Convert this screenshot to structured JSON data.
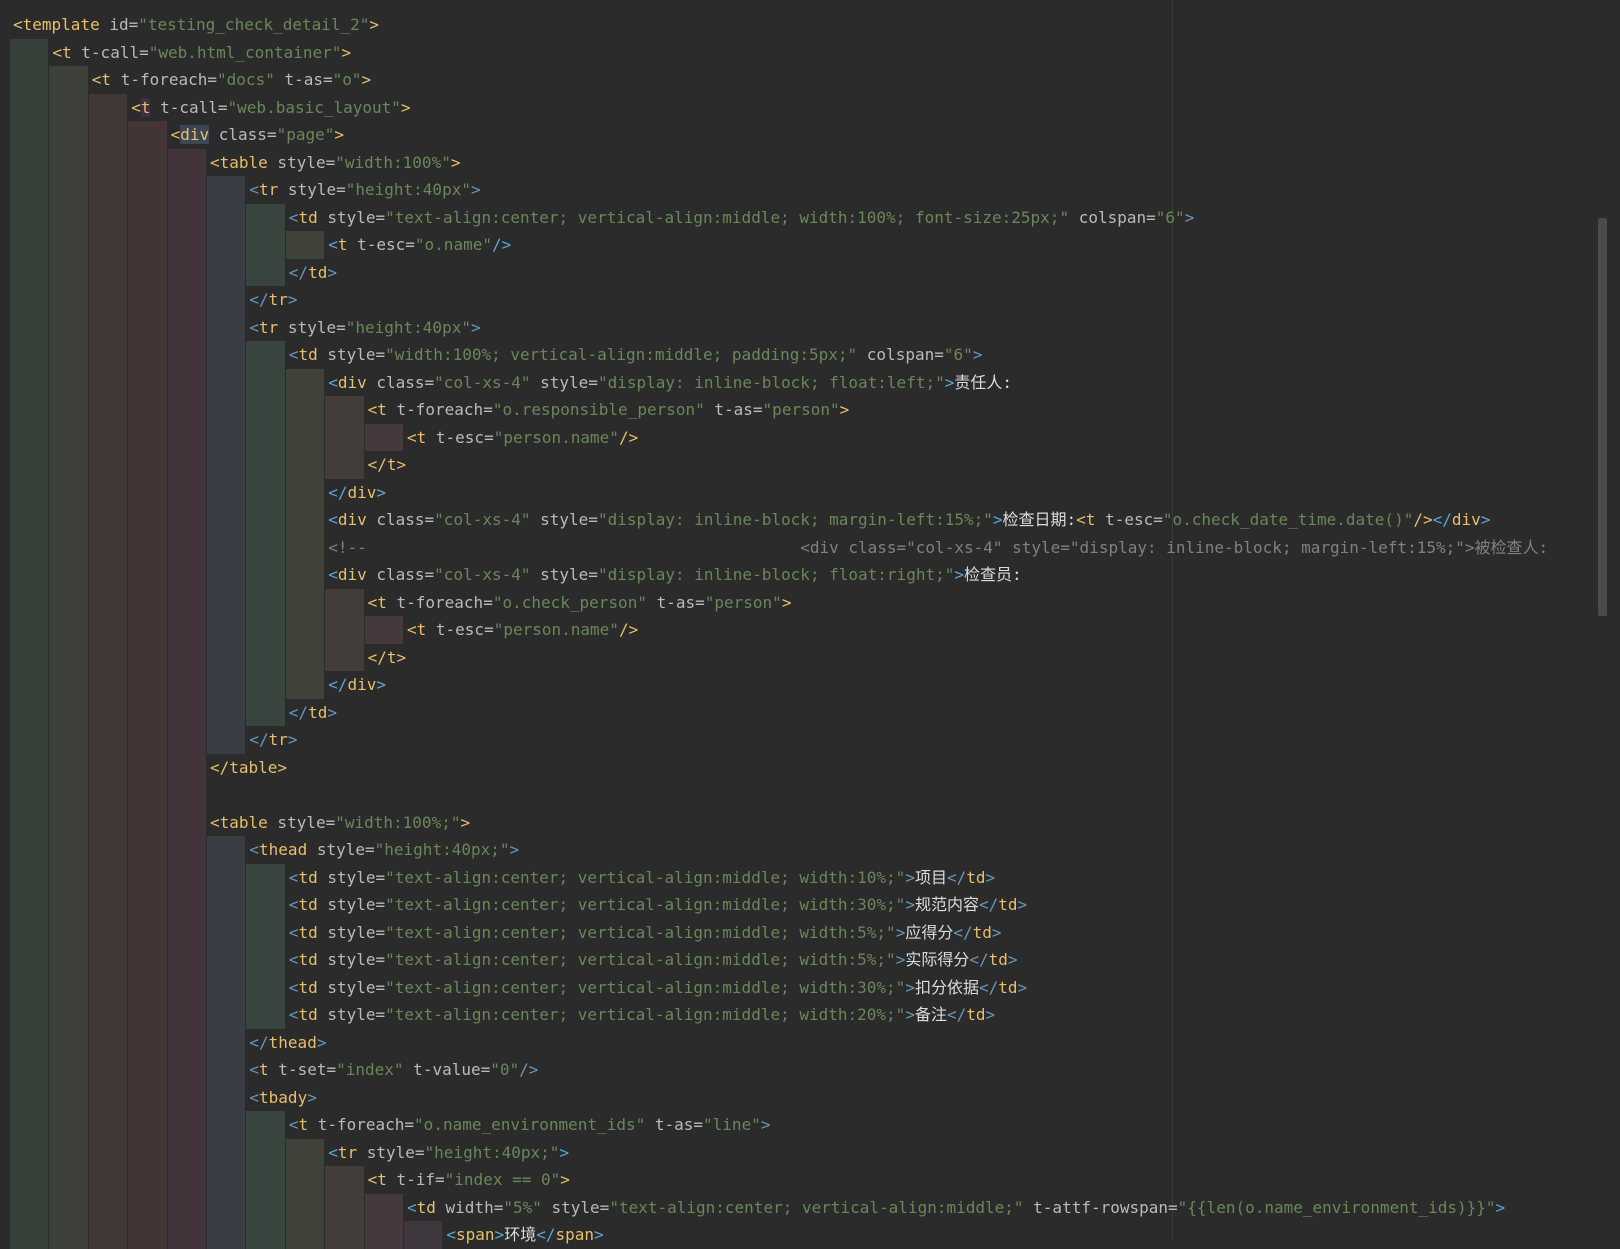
{
  "lines": [
    {
      "indent": 0,
      "tokens": [
        [
          "t",
          "<"
        ],
        [
          "t",
          "template"
        ],
        [
          "a",
          " id="
        ],
        [
          "s",
          "\"testing_check_detail_2\""
        ],
        [
          "t",
          ">"
        ]
      ]
    },
    {
      "indent": 1,
      "tokens": [
        [
          "t",
          "<t"
        ],
        [
          "a",
          " t-call="
        ],
        [
          "s",
          "\"web.html_container\""
        ],
        [
          "t",
          ">"
        ]
      ]
    },
    {
      "indent": 2,
      "tokens": [
        [
          "t",
          "<t"
        ],
        [
          "a",
          " t-foreach="
        ],
        [
          "s",
          "\"docs\""
        ],
        [
          "a",
          " t-as="
        ],
        [
          "s",
          "\"o\""
        ],
        [
          "t",
          ">"
        ]
      ]
    },
    {
      "indent": 3,
      "tokens": [
        [
          "t",
          "<"
        ],
        [
          "thl",
          "t"
        ],
        [
          "a",
          " t-call="
        ],
        [
          "s",
          "\"web.basic_layout\""
        ],
        [
          "t",
          ">"
        ]
      ]
    },
    {
      "indent": 4,
      "tokens": [
        [
          "t",
          "<"
        ],
        [
          "tmb",
          "div"
        ],
        [
          "a",
          " class="
        ],
        [
          "s",
          "\"page\""
        ],
        [
          "t",
          ">"
        ]
      ]
    },
    {
      "indent": 5,
      "tokens": [
        [
          "t",
          "<table"
        ],
        [
          "a",
          " style="
        ],
        [
          "s",
          "\"width:100%\""
        ],
        [
          "t",
          ">"
        ]
      ]
    },
    {
      "indent": 6,
      "tokens": [
        [
          "p",
          "<"
        ],
        [
          "t",
          "tr"
        ],
        [
          "a",
          " style="
        ],
        [
          "s",
          "\"height:40px\""
        ],
        [
          "p",
          ">"
        ]
      ]
    },
    {
      "indent": 7,
      "tokens": [
        [
          "p",
          "<"
        ],
        [
          "t",
          "td"
        ],
        [
          "a",
          " style="
        ],
        [
          "s",
          "\"text-align:center; vertical-align:middle; width:100%; font-size:25px;\""
        ],
        [
          "a",
          " colspan="
        ],
        [
          "s",
          "\"6\""
        ],
        [
          "p",
          ">"
        ]
      ]
    },
    {
      "indent": 8,
      "tokens": [
        [
          "b",
          "<"
        ],
        [
          "t",
          "t"
        ],
        [
          "a",
          " t-esc="
        ],
        [
          "s",
          "\"o.name\""
        ],
        [
          "b",
          "/>"
        ]
      ]
    },
    {
      "indent": 7,
      "tokens": [
        [
          "p",
          "</"
        ],
        [
          "t",
          "td"
        ],
        [
          "p",
          ">"
        ]
      ]
    },
    {
      "indent": 6,
      "tokens": [
        [
          "p",
          "</"
        ],
        [
          "t",
          "tr"
        ],
        [
          "p",
          ">"
        ]
      ]
    },
    {
      "indent": 6,
      "tokens": [
        [
          "p",
          "<"
        ],
        [
          "t",
          "tr"
        ],
        [
          "a",
          " style="
        ],
        [
          "s",
          "\"height:40px\""
        ],
        [
          "p",
          ">"
        ]
      ]
    },
    {
      "indent": 7,
      "tokens": [
        [
          "p",
          "<"
        ],
        [
          "t",
          "td"
        ],
        [
          "a",
          " style="
        ],
        [
          "s",
          "\"width:100%; vertical-align:middle; padding:5px;\""
        ],
        [
          "a",
          " colspan="
        ],
        [
          "s",
          "\"6\""
        ],
        [
          "p",
          ">"
        ]
      ]
    },
    {
      "indent": 8,
      "tokens": [
        [
          "b",
          "<"
        ],
        [
          "t",
          "div"
        ],
        [
          "a",
          " class="
        ],
        [
          "s",
          "\"col-xs-4\""
        ],
        [
          "a",
          " style="
        ],
        [
          "s",
          "\"display: inline-block; float:left;\""
        ],
        [
          "b",
          ">"
        ],
        [
          "x",
          "责任人:"
        ]
      ]
    },
    {
      "indent": 9,
      "tokens": [
        [
          "t",
          "<t"
        ],
        [
          "a",
          " t-foreach="
        ],
        [
          "s",
          "\"o.responsible_person\""
        ],
        [
          "a",
          " t-as="
        ],
        [
          "s",
          "\"person\""
        ],
        [
          "t",
          ">"
        ]
      ]
    },
    {
      "indent": 10,
      "tokens": [
        [
          "t",
          "<t"
        ],
        [
          "a",
          " t-esc="
        ],
        [
          "s",
          "\"person.name\""
        ],
        [
          "t",
          "/>"
        ]
      ]
    },
    {
      "indent": 9,
      "tokens": [
        [
          "t",
          "</t>"
        ]
      ]
    },
    {
      "indent": 8,
      "tokens": [
        [
          "b",
          "</"
        ],
        [
          "t",
          "div"
        ],
        [
          "b",
          ">"
        ]
      ]
    },
    {
      "indent": 8,
      "tokens": [
        [
          "b",
          "<"
        ],
        [
          "t",
          "div"
        ],
        [
          "a",
          " class="
        ],
        [
          "s",
          "\"col-xs-4\""
        ],
        [
          "a",
          " style="
        ],
        [
          "s",
          "\"display: inline-block; margin-left:15%;\""
        ],
        [
          "b",
          ">"
        ],
        [
          "x",
          "检查日期:"
        ],
        [
          "t",
          "<t"
        ],
        [
          "a",
          " t-esc="
        ],
        [
          "s",
          "\"o.check_date_time.date()\""
        ],
        [
          "t",
          "/>"
        ],
        [
          "b",
          "</"
        ],
        [
          "t",
          "div"
        ],
        [
          "b",
          ">"
        ]
      ]
    },
    {
      "indent": 8,
      "tokens": [
        [
          "c",
          "<!--                                             <div class=\"col-xs-4\" style=\"display: inline-block; margin-left:15%;\">被检查人:"
        ]
      ]
    },
    {
      "indent": 8,
      "tokens": [
        [
          "b",
          "<"
        ],
        [
          "t",
          "div"
        ],
        [
          "a",
          " class="
        ],
        [
          "s",
          "\"col-xs-4\""
        ],
        [
          "a",
          " style="
        ],
        [
          "s",
          "\"display: inline-block; float:right;\""
        ],
        [
          "b",
          ">"
        ],
        [
          "x",
          "检查员:"
        ]
      ]
    },
    {
      "indent": 9,
      "tokens": [
        [
          "t",
          "<t"
        ],
        [
          "a",
          " t-foreach="
        ],
        [
          "s",
          "\"o.check_person\""
        ],
        [
          "a",
          " t-as="
        ],
        [
          "s",
          "\"person\""
        ],
        [
          "t",
          ">"
        ]
      ]
    },
    {
      "indent": 10,
      "tokens": [
        [
          "t",
          "<t"
        ],
        [
          "a",
          " t-esc="
        ],
        [
          "s",
          "\"person.name\""
        ],
        [
          "t",
          "/>"
        ]
      ]
    },
    {
      "indent": 9,
      "tokens": [
        [
          "t",
          "</t>"
        ]
      ]
    },
    {
      "indent": 8,
      "tokens": [
        [
          "b",
          "</"
        ],
        [
          "t",
          "div"
        ],
        [
          "b",
          ">"
        ]
      ]
    },
    {
      "indent": 7,
      "tokens": [
        [
          "p",
          "</"
        ],
        [
          "t",
          "td"
        ],
        [
          "p",
          ">"
        ]
      ]
    },
    {
      "indent": 6,
      "tokens": [
        [
          "p",
          "</"
        ],
        [
          "t",
          "tr"
        ],
        [
          "p",
          ">"
        ]
      ]
    },
    {
      "indent": 5,
      "tokens": [
        [
          "t",
          "</table>"
        ]
      ]
    },
    {
      "indent": 0,
      "tokens": []
    },
    {
      "indent": 5,
      "tokens": [
        [
          "t",
          "<table"
        ],
        [
          "a",
          " style="
        ],
        [
          "s",
          "\"width:100%;\""
        ],
        [
          "t",
          ">"
        ]
      ]
    },
    {
      "indent": 6,
      "tokens": [
        [
          "p",
          "<"
        ],
        [
          "t",
          "thead"
        ],
        [
          "a",
          " style="
        ],
        [
          "s",
          "\"height:40px;\""
        ],
        [
          "p",
          ">"
        ]
      ]
    },
    {
      "indent": 7,
      "tokens": [
        [
          "p",
          "<"
        ],
        [
          "t",
          "td"
        ],
        [
          "a",
          " style="
        ],
        [
          "s",
          "\"text-align:center; vertical-align:middle; width:10%;\""
        ],
        [
          "p",
          ">"
        ],
        [
          "x",
          "项目"
        ],
        [
          "p",
          "</"
        ],
        [
          "t",
          "td"
        ],
        [
          "p",
          ">"
        ]
      ]
    },
    {
      "indent": 7,
      "tokens": [
        [
          "p",
          "<"
        ],
        [
          "t",
          "td"
        ],
        [
          "a",
          " style="
        ],
        [
          "s",
          "\"text-align:center; vertical-align:middle; width:30%;\""
        ],
        [
          "p",
          ">"
        ],
        [
          "x",
          "规范内容"
        ],
        [
          "p",
          "</"
        ],
        [
          "t",
          "td"
        ],
        [
          "p",
          ">"
        ]
      ]
    },
    {
      "indent": 7,
      "tokens": [
        [
          "p",
          "<"
        ],
        [
          "t",
          "td"
        ],
        [
          "a",
          " style="
        ],
        [
          "s",
          "\"text-align:center; vertical-align:middle; width:5%;\""
        ],
        [
          "p",
          ">"
        ],
        [
          "x",
          "应得分"
        ],
        [
          "p",
          "</"
        ],
        [
          "t",
          "td"
        ],
        [
          "p",
          ">"
        ]
      ]
    },
    {
      "indent": 7,
      "tokens": [
        [
          "p",
          "<"
        ],
        [
          "t",
          "td"
        ],
        [
          "a",
          " style="
        ],
        [
          "s",
          "\"text-align:center; vertical-align:middle; width:5%;\""
        ],
        [
          "p",
          ">"
        ],
        [
          "x",
          "实际得分"
        ],
        [
          "p",
          "</"
        ],
        [
          "t",
          "td"
        ],
        [
          "p",
          ">"
        ]
      ]
    },
    {
      "indent": 7,
      "tokens": [
        [
          "p",
          "<"
        ],
        [
          "t",
          "td"
        ],
        [
          "a",
          " style="
        ],
        [
          "s",
          "\"text-align:center; vertical-align:middle; width:30%;\""
        ],
        [
          "p",
          ">"
        ],
        [
          "x",
          "扣分依据"
        ],
        [
          "p",
          "</"
        ],
        [
          "t",
          "td"
        ],
        [
          "p",
          ">"
        ]
      ]
    },
    {
      "indent": 7,
      "tokens": [
        [
          "p",
          "<"
        ],
        [
          "t",
          "td"
        ],
        [
          "a",
          " style="
        ],
        [
          "s",
          "\"text-align:center; vertical-align:middle; width:20%;\""
        ],
        [
          "p",
          ">"
        ],
        [
          "x",
          "备注"
        ],
        [
          "p",
          "</"
        ],
        [
          "t",
          "td"
        ],
        [
          "p",
          ">"
        ]
      ]
    },
    {
      "indent": 6,
      "tokens": [
        [
          "p",
          "</"
        ],
        [
          "t",
          "thead"
        ],
        [
          "p",
          ">"
        ]
      ]
    },
    {
      "indent": 6,
      "tokens": [
        [
          "p",
          "<"
        ],
        [
          "t",
          "t"
        ],
        [
          "a",
          " t-set="
        ],
        [
          "s",
          "\"index\""
        ],
        [
          "a",
          " t-value="
        ],
        [
          "s",
          "\"0\""
        ],
        [
          "p",
          "/>"
        ]
      ]
    },
    {
      "indent": 6,
      "tokens": [
        [
          "p",
          "<"
        ],
        [
          "t",
          "tbady"
        ],
        [
          "p",
          ">"
        ]
      ]
    },
    {
      "indent": 7,
      "tokens": [
        [
          "p",
          "<"
        ],
        [
          "t",
          "t"
        ],
        [
          "a",
          " t-foreach="
        ],
        [
          "s",
          "\"o.name_environment_ids\""
        ],
        [
          "a",
          " t-as="
        ],
        [
          "s",
          "\"line\""
        ],
        [
          "p",
          ">"
        ]
      ]
    },
    {
      "indent": 8,
      "tokens": [
        [
          "b",
          "<"
        ],
        [
          "t",
          "tr"
        ],
        [
          "a",
          " style="
        ],
        [
          "s",
          "\"height:40px;\""
        ],
        [
          "b",
          ">"
        ]
      ]
    },
    {
      "indent": 9,
      "tokens": [
        [
          "t",
          "<t"
        ],
        [
          "a",
          " t-if="
        ],
        [
          "s",
          "\"index == 0\""
        ],
        [
          "t",
          ">"
        ]
      ]
    },
    {
      "indent": 10,
      "tokens": [
        [
          "b",
          "<"
        ],
        [
          "t",
          "td"
        ],
        [
          "a",
          " width="
        ],
        [
          "s",
          "\"5%\""
        ],
        [
          "a",
          " style="
        ],
        [
          "s",
          "\"text-align:center; vertical-align:middle;\""
        ],
        [
          "a",
          " t-attf-rowspan="
        ],
        [
          "s",
          "\"{{len(o.name_environment_ids)}}\""
        ],
        [
          "b",
          ">"
        ]
      ]
    },
    {
      "indent": 11,
      "tokens": [
        [
          "b",
          "<"
        ],
        [
          "t",
          "span"
        ],
        [
          "b",
          ">"
        ],
        [
          "x",
          "环境"
        ],
        [
          "b",
          "</"
        ],
        [
          "t",
          "span"
        ],
        [
          "b",
          ">"
        ]
      ]
    }
  ],
  "colors": {
    "background": "#2b2b2b",
    "tag": "#e8bf6a",
    "attribute": "#bababa",
    "string": "#6a8759",
    "bracket_purple": "#6897bb",
    "bracket_blue": "#59a7d8",
    "comment": "#808080",
    "text": "#dcdcdc",
    "guide_palette": [
      "#354139",
      "#3d3f39",
      "#3f3835",
      "#433435",
      "#43333a",
      "#3a3d44",
      "#38443e",
      "#3e4238",
      "#423d39",
      "#46393b",
      "#3e373e"
    ]
  }
}
